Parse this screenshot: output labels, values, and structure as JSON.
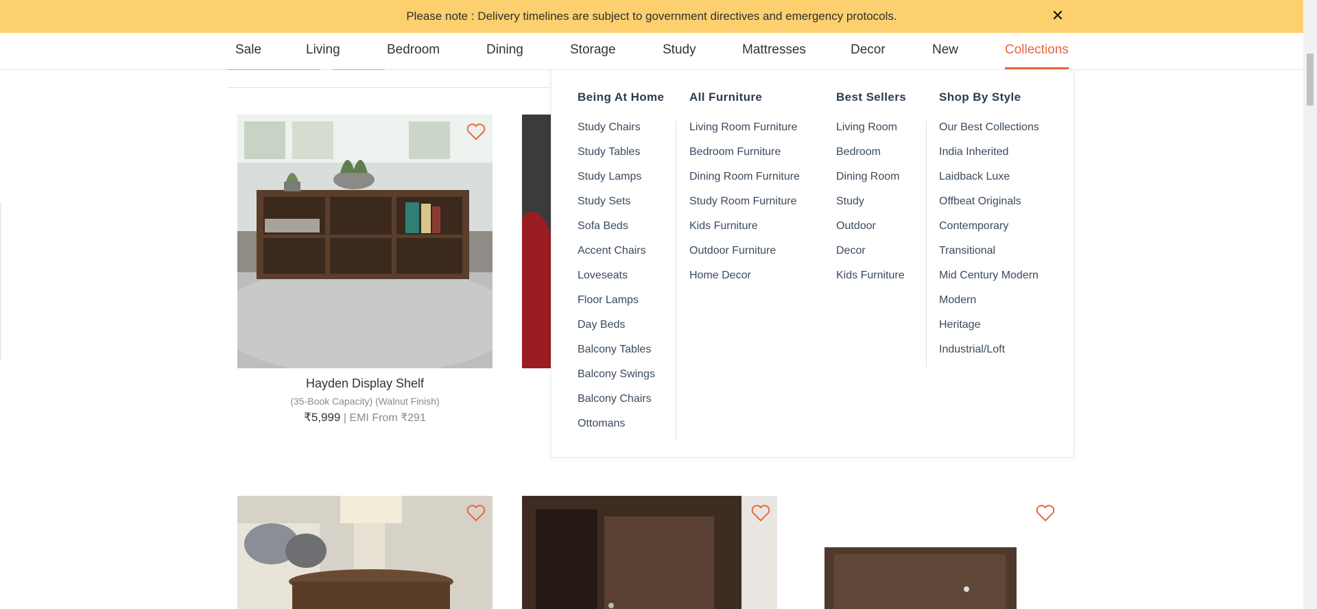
{
  "notice": {
    "text": "Please note : Delivery timelines are subject to government directives and emergency protocols.",
    "close_icon": "close-icon"
  },
  "nav": {
    "items": [
      "Sale",
      "Living",
      "Bedroom",
      "Dining",
      "Storage",
      "Study",
      "Mattresses",
      "Decor",
      "New",
      "Collections"
    ],
    "active": "Collections",
    "accent_color": "#e8663d"
  },
  "products": [
    {
      "name": "Hayden Display Shelf",
      "sub": "(35-Book Capacity) (Walnut Finish)",
      "price": "₹5,999",
      "emi": " | EMI From ₹291"
    }
  ],
  "mega_menu": {
    "columns": [
      {
        "title": "Being At Home",
        "items": [
          "Study Chairs",
          "Study Tables",
          "Study Lamps",
          "Study Sets",
          "Sofa Beds",
          "Accent Chairs",
          "Loveseats",
          "Floor Lamps",
          "Day Beds",
          "Balcony Tables",
          "Balcony Swings",
          "Balcony Chairs",
          "Ottomans"
        ]
      },
      {
        "title": "All Furniture",
        "items": [
          "Living Room Furniture",
          "Bedroom Furniture",
          "Dining Room Furniture",
          "Study Room Furniture",
          "Kids Furniture",
          "Outdoor Furniture",
          "Home Decor"
        ]
      },
      {
        "title": "Best Sellers",
        "items": [
          "Living Room",
          "Bedroom",
          "Dining Room",
          "Study",
          "Outdoor",
          "Decor",
          "Kids Furniture"
        ]
      },
      {
        "title": "Shop By Style",
        "items": [
          "Our Best Collections",
          "India Inherited",
          "Laidback Luxe",
          "Offbeat Originals",
          "Contemporary",
          "Transitional",
          "Mid Century Modern",
          "Modern",
          "Heritage",
          "Industrial/Loft"
        ]
      }
    ]
  }
}
